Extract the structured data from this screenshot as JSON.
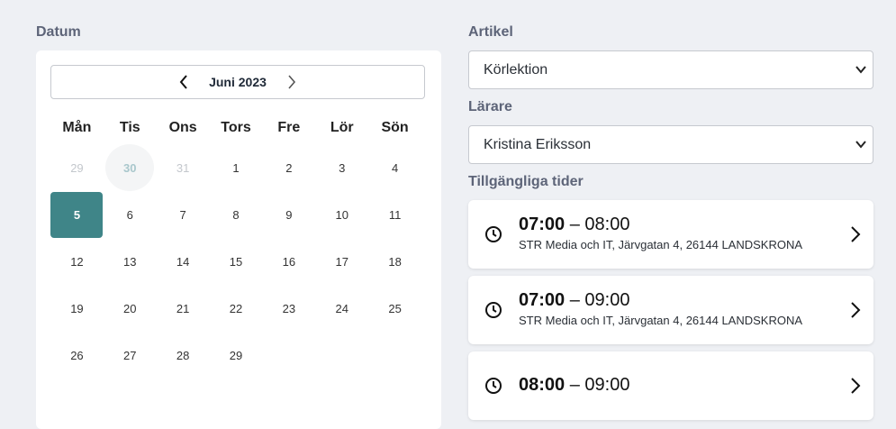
{
  "datum_label": "Datum",
  "artikel_label": "Artikel",
  "larare_label": "Lärare",
  "tider_label": "Tillgängliga tider",
  "calendar": {
    "month": "Juni 2023",
    "weekdays": [
      "Mån",
      "Tis",
      "Ons",
      "Tors",
      "Fre",
      "Lör",
      "Sön"
    ],
    "days": [
      {
        "d": "29",
        "state": "muted"
      },
      {
        "d": "30",
        "state": "today"
      },
      {
        "d": "31",
        "state": "muted"
      },
      {
        "d": "1"
      },
      {
        "d": "2"
      },
      {
        "d": "3"
      },
      {
        "d": "4"
      },
      {
        "d": "5",
        "state": "selected"
      },
      {
        "d": "6"
      },
      {
        "d": "7"
      },
      {
        "d": "8"
      },
      {
        "d": "9"
      },
      {
        "d": "10"
      },
      {
        "d": "11"
      },
      {
        "d": "12"
      },
      {
        "d": "13"
      },
      {
        "d": "14"
      },
      {
        "d": "15"
      },
      {
        "d": "16"
      },
      {
        "d": "17"
      },
      {
        "d": "18"
      },
      {
        "d": "19"
      },
      {
        "d": "20"
      },
      {
        "d": "21"
      },
      {
        "d": "22"
      },
      {
        "d": "23"
      },
      {
        "d": "24"
      },
      {
        "d": "25"
      },
      {
        "d": "26"
      },
      {
        "d": "27"
      },
      {
        "d": "28"
      },
      {
        "d": "29"
      }
    ]
  },
  "artikel_value": "Körlektion",
  "larare_value": "Kristina Eriksson",
  "slots": [
    {
      "start": "07:00",
      "sep": " – ",
      "end": "08:00",
      "location": "STR Media och IT, Järvgatan 4, 26144 LANDSKRONA"
    },
    {
      "start": "07:00",
      "sep": " – ",
      "end": "09:00",
      "location": "STR Media och IT, Järvgatan 4, 26144 LANDSKRONA"
    },
    {
      "start": "08:00",
      "sep": " – ",
      "end": "09:00",
      "location": ""
    }
  ],
  "colors": {
    "accent": "#3f8588",
    "background": "#eef0f4"
  }
}
